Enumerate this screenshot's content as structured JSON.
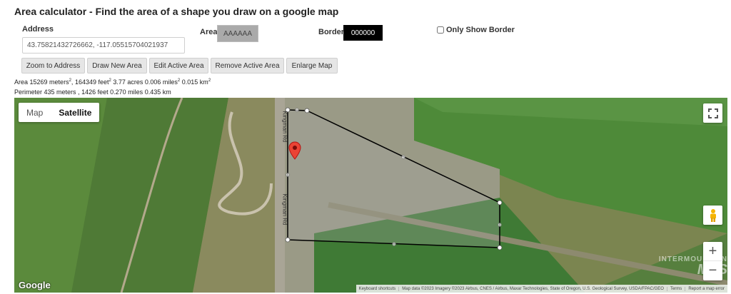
{
  "page": {
    "title": "Area calculator - Find the area of a shape you draw on a google map"
  },
  "form": {
    "address_label": "Address",
    "address_value": "43.75821432726662, -117.05515704021937",
    "area_label": "Area",
    "area_color": "AAAAAA",
    "border_label": "Border",
    "border_color": "000000",
    "only_border_label": "Only Show Border",
    "only_border_checked": false
  },
  "buttons": {
    "zoom": "Zoom to Address",
    "draw": "Draw New Area",
    "edit": "Edit Active Area",
    "remove": "Remove Active Area",
    "enlarge": "Enlarge Map"
  },
  "results": {
    "area_label": "Area",
    "area_m": "15269 meters",
    "area_ft": "164349 feet",
    "area_acres": "3.77 acres",
    "area_miles": "0.006 miles",
    "area_km": "0.015 km",
    "perimeter_label": "Perimeter",
    "perimeter_m": "435 meters",
    "perimeter_ft": "1426 feet",
    "perimeter_mi": "0.270 miles",
    "perimeter_km": "0.435 km"
  },
  "map": {
    "type_map": "Map",
    "type_satellite": "Satellite",
    "selected_type": "Satellite",
    "road_label": "Kingman Rd",
    "watermark_line1": "INTERMOUNTAIN",
    "watermark_line2": "MLS",
    "google_logo": "Google",
    "zoom_in": "+",
    "zoom_out": "−",
    "attribution": {
      "shortcuts": "Keyboard shortcuts",
      "data": "Map data ©2023 Imagery ©2023 Airbus, CNES / Airbus, Maxar Technologies, State of Oregon, U.S. Geological Survey, USDA/FPAC/GEO",
      "terms": "Terms",
      "report": "Report a map error"
    }
  },
  "colors": {
    "area_fill": "#aaaaaa",
    "border": "#000000",
    "marker": "#ea4335"
  },
  "icons": {
    "fullscreen": "fullscreen-icon",
    "pegman": "pegman-icon",
    "marker": "map-marker-icon"
  }
}
